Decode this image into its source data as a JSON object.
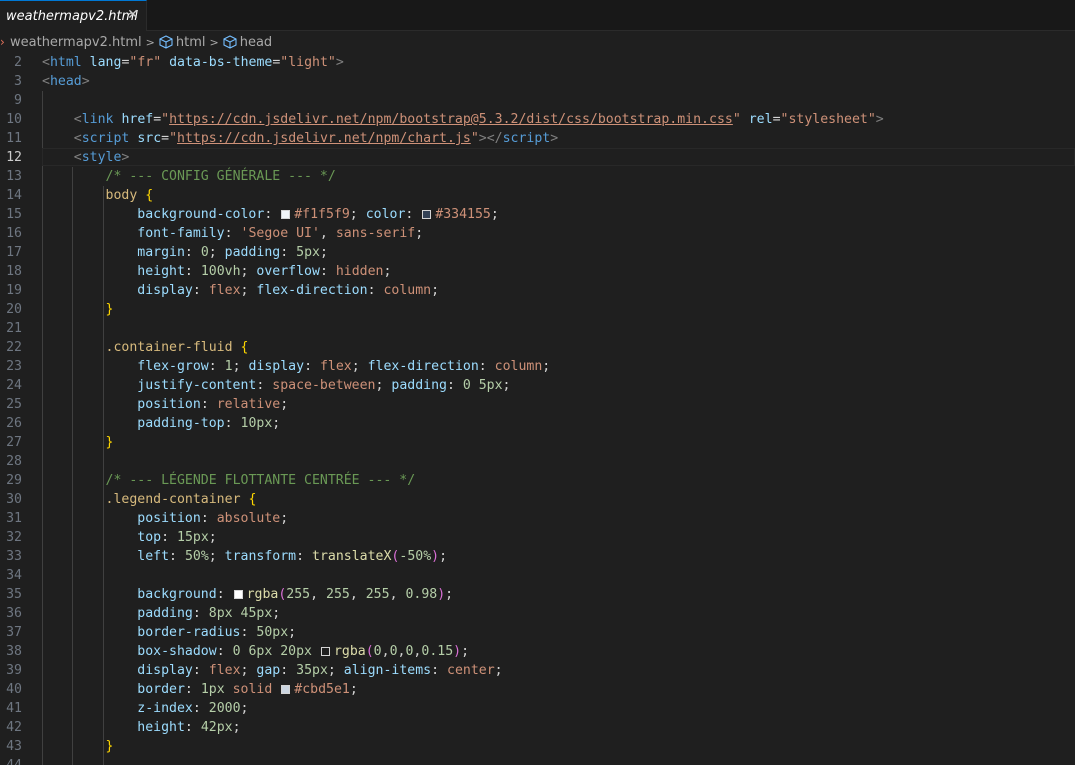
{
  "tab": {
    "title": "weathermapv2.html",
    "close_glyph": "✕"
  },
  "breadcrumb": {
    "file": "weathermapv2.html",
    "items": [
      "html",
      "head"
    ]
  },
  "editor": {
    "active_line": "12",
    "lines": [
      {
        "n": "2",
        "html": "<span class=\"t-br\">&lt;</span><span class=\"t-tag\">html</span> <span class=\"t-attr\">lang</span><span class=\"t-pl\">=</span><span class=\"t-str\">\"fr\"</span> <span class=\"t-attr\">data-bs-theme</span><span class=\"t-pl\">=</span><span class=\"t-str\">\"light\"</span><span class=\"t-br\">&gt;</span>"
      },
      {
        "n": "3",
        "html": "<span class=\"t-br\">&lt;</span><span class=\"t-tag\">head</span><span class=\"t-br\">&gt;</span>"
      },
      {
        "n": "9",
        "html": ""
      },
      {
        "n": "10",
        "html": "    <span class=\"t-br\">&lt;</span><span class=\"t-tag\">link</span> <span class=\"t-attr\">href</span><span class=\"t-pl\">=</span><span class=\"t-str\">\"</span><span class=\"t-url\">https://cdn.jsdelivr.net/npm/bootstrap@5.3.2/dist/css/bootstrap.min.css</span><span class=\"t-str\">\"</span> <span class=\"t-attr\">rel</span><span class=\"t-pl\">=</span><span class=\"t-str\">\"stylesheet\"</span><span class=\"t-br\">&gt;</span>"
      },
      {
        "n": "11",
        "html": "    <span class=\"t-br\">&lt;</span><span class=\"t-tag\">script</span> <span class=\"t-attr\">src</span><span class=\"t-pl\">=</span><span class=\"t-str\">\"</span><span class=\"t-url\">https://cdn.jsdelivr.net/npm/chart.js</span><span class=\"t-str\">\"</span><span class=\"t-br\">&gt;&lt;/</span><span class=\"t-tag\">script</span><span class=\"t-br\">&gt;</span>"
      },
      {
        "n": "12",
        "html": "    <span class=\"t-br\">&lt;</span><span class=\"t-tag\">style</span><span class=\"t-br\">&gt;</span>"
      },
      {
        "n": "13",
        "html": "        <span class=\"t-cmt\">/* --- CONFIG GÉNÉRALE --- */</span>"
      },
      {
        "n": "14",
        "html": "        <span class=\"t-sel\">body</span> <span class=\"t-brace\">{</span>"
      },
      {
        "n": "15",
        "html": "            <span class=\"t-prop\">background-color</span><span class=\"t-pl\">: </span><span class=\"swatch\" style=\"background:#f1f5f9\"></span><span class=\"t-val\">#f1f5f9</span><span class=\"t-pl\">; </span><span class=\"t-prop\">color</span><span class=\"t-pl\">: </span><span class=\"swatch\" style=\"background:#334155\"></span><span class=\"t-val\">#334155</span><span class=\"t-pl\">;</span>"
      },
      {
        "n": "16",
        "html": "            <span class=\"t-prop\">font-family</span><span class=\"t-pl\">: </span><span class=\"t-str\">'Segoe UI'</span><span class=\"t-pl\">, </span><span class=\"t-val\">sans-serif</span><span class=\"t-pl\">;</span>"
      },
      {
        "n": "17",
        "html": "            <span class=\"t-prop\">margin</span><span class=\"t-pl\">: </span><span class=\"t-num\">0</span><span class=\"t-pl\">; </span><span class=\"t-prop\">padding</span><span class=\"t-pl\">: </span><span class=\"t-num\">5px</span><span class=\"t-pl\">;</span>"
      },
      {
        "n": "18",
        "html": "            <span class=\"t-prop\">height</span><span class=\"t-pl\">: </span><span class=\"t-num\">100vh</span><span class=\"t-pl\">; </span><span class=\"t-prop\">overflow</span><span class=\"t-pl\">: </span><span class=\"t-val\">hidden</span><span class=\"t-pl\">;</span>"
      },
      {
        "n": "19",
        "html": "            <span class=\"t-prop\">display</span><span class=\"t-pl\">: </span><span class=\"t-val\">flex</span><span class=\"t-pl\">; </span><span class=\"t-prop\">flex-direction</span><span class=\"t-pl\">: </span><span class=\"t-val\">column</span><span class=\"t-pl\">;</span>"
      },
      {
        "n": "20",
        "html": "        <span class=\"t-brace\">}</span>"
      },
      {
        "n": "21",
        "html": ""
      },
      {
        "n": "22",
        "html": "        <span class=\"t-sel\">.container-fluid</span> <span class=\"t-brace\">{</span>"
      },
      {
        "n": "23",
        "html": "            <span class=\"t-prop\">flex-grow</span><span class=\"t-pl\">: </span><span class=\"t-num\">1</span><span class=\"t-pl\">; </span><span class=\"t-prop\">display</span><span class=\"t-pl\">: </span><span class=\"t-val\">flex</span><span class=\"t-pl\">; </span><span class=\"t-prop\">flex-direction</span><span class=\"t-pl\">: </span><span class=\"t-val\">column</span><span class=\"t-pl\">;</span>"
      },
      {
        "n": "24",
        "html": "            <span class=\"t-prop\">justify-content</span><span class=\"t-pl\">: </span><span class=\"t-val\">space-between</span><span class=\"t-pl\">; </span><span class=\"t-prop\">padding</span><span class=\"t-pl\">: </span><span class=\"t-num\">0 5px</span><span class=\"t-pl\">;</span>"
      },
      {
        "n": "25",
        "html": "            <span class=\"t-prop\">position</span><span class=\"t-pl\">: </span><span class=\"t-val\">relative</span><span class=\"t-pl\">;</span>"
      },
      {
        "n": "26",
        "html": "            <span class=\"t-prop\">padding-top</span><span class=\"t-pl\">: </span><span class=\"t-num\">10px</span><span class=\"t-pl\">;</span>"
      },
      {
        "n": "27",
        "html": "        <span class=\"t-brace\">}</span>"
      },
      {
        "n": "28",
        "html": ""
      },
      {
        "n": "29",
        "html": "        <span class=\"t-cmt\">/* --- LÉGENDE FLOTTANTE CENTRÉE --- */</span>"
      },
      {
        "n": "30",
        "html": "        <span class=\"t-sel\">.legend-container</span> <span class=\"t-brace\">{</span>"
      },
      {
        "n": "31",
        "html": "            <span class=\"t-prop\">position</span><span class=\"t-pl\">: </span><span class=\"t-val\">absolute</span><span class=\"t-pl\">;</span>"
      },
      {
        "n": "32",
        "html": "            <span class=\"t-prop\">top</span><span class=\"t-pl\">: </span><span class=\"t-num\">15px</span><span class=\"t-pl\">;</span>"
      },
      {
        "n": "33",
        "html": "            <span class=\"t-prop\">left</span><span class=\"t-pl\">: </span><span class=\"t-num\">50%</span><span class=\"t-pl\">; </span><span class=\"t-prop\">transform</span><span class=\"t-pl\">: </span><span class=\"t-fn\">translateX</span><span class=\"t-paren\">(</span><span class=\"t-num\">-50%</span><span class=\"t-paren\">)</span><span class=\"t-pl\">;</span>"
      },
      {
        "n": "34",
        "html": ""
      },
      {
        "n": "35",
        "html": "            <span class=\"t-prop\">background</span><span class=\"t-pl\">: </span><span class=\"swatch\" style=\"background:#ffffff\"></span><span class=\"t-fn\">rgba</span><span class=\"t-paren\">(</span><span class=\"t-num\">255</span><span class=\"t-pl\">, </span><span class=\"t-num\">255</span><span class=\"t-pl\">, </span><span class=\"t-num\">255</span><span class=\"t-pl\">, </span><span class=\"t-num\">0.98</span><span class=\"t-paren\">)</span><span class=\"t-pl\">;</span>"
      },
      {
        "n": "36",
        "html": "            <span class=\"t-prop\">padding</span><span class=\"t-pl\">: </span><span class=\"t-num\">8px 45px</span><span class=\"t-pl\">;</span>"
      },
      {
        "n": "37",
        "html": "            <span class=\"t-prop\">border-radius</span><span class=\"t-pl\">: </span><span class=\"t-num\">50px</span><span class=\"t-pl\">;</span>"
      },
      {
        "n": "38",
        "html": "            <span class=\"t-prop\">box-shadow</span><span class=\"t-pl\">: </span><span class=\"t-num\">0 6px 20px</span><span class=\"t-pl\"> </span><span class=\"swatch\" style=\"background:#1f1f1f\"></span><span class=\"t-fn\">rgba</span><span class=\"t-paren\">(</span><span class=\"t-num\">0</span><span class=\"t-pl\">,</span><span class=\"t-num\">0</span><span class=\"t-pl\">,</span><span class=\"t-num\">0</span><span class=\"t-pl\">,</span><span class=\"t-num\">0.15</span><span class=\"t-paren\">)</span><span class=\"t-pl\">;</span>"
      },
      {
        "n": "39",
        "html": "            <span class=\"t-prop\">display</span><span class=\"t-pl\">: </span><span class=\"t-val\">flex</span><span class=\"t-pl\">; </span><span class=\"t-prop\">gap</span><span class=\"t-pl\">: </span><span class=\"t-num\">35px</span><span class=\"t-pl\">; </span><span class=\"t-prop\">align-items</span><span class=\"t-pl\">: </span><span class=\"t-val\">center</span><span class=\"t-pl\">;</span>"
      },
      {
        "n": "40",
        "html": "            <span class=\"t-prop\">border</span><span class=\"t-pl\">: </span><span class=\"t-num\">1px</span><span class=\"t-pl\"> </span><span class=\"t-val\">solid</span><span class=\"t-pl\"> </span><span class=\"swatch\" style=\"background:#cbd5e1\"></span><span class=\"t-val\">#cbd5e1</span><span class=\"t-pl\">;</span>"
      },
      {
        "n": "41",
        "html": "            <span class=\"t-prop\">z-index</span><span class=\"t-pl\">: </span><span class=\"t-num\">2000</span><span class=\"t-pl\">;</span>"
      },
      {
        "n": "42",
        "html": "            <span class=\"t-prop\">height</span><span class=\"t-pl\">: </span><span class=\"t-num\">42px</span><span class=\"t-pl\">;</span>"
      },
      {
        "n": "43",
        "html": "        <span class=\"t-brace\">}</span>"
      },
      {
        "n": "44",
        "html": ""
      }
    ]
  }
}
